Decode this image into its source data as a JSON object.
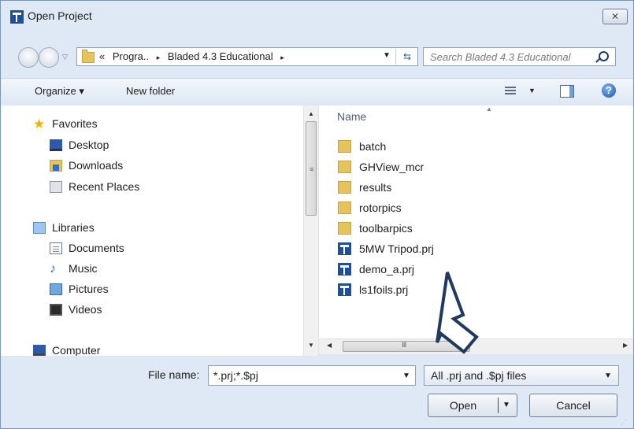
{
  "window": {
    "title": "Open Project",
    "close_label": "⨯"
  },
  "navigation": {
    "breadcrumbs": [
      "«",
      "Progra..",
      "▸",
      "Bladed 4.3 Educational",
      "▸"
    ],
    "search_placeholder": "Search Bladed 4.3 Educational"
  },
  "toolbar": {
    "organize_label": "Organize ▾",
    "new_folder_label": "New folder",
    "help_label": "?"
  },
  "sidebar": {
    "items": [
      {
        "label": "Favorites",
        "icon": "star-icon"
      },
      {
        "label": "Desktop",
        "icon": "desktop-icon"
      },
      {
        "label": "Downloads",
        "icon": "downloads-icon"
      },
      {
        "label": "Recent Places",
        "icon": "recent-places-icon"
      },
      {
        "label": "Libraries",
        "icon": "libraries-icon"
      },
      {
        "label": "Documents",
        "icon": "documents-icon"
      },
      {
        "label": "Music",
        "icon": "music-icon"
      },
      {
        "label": "Pictures",
        "icon": "pictures-icon"
      },
      {
        "label": "Videos",
        "icon": "videos-icon"
      },
      {
        "label": "Computer",
        "icon": "computer-icon"
      }
    ]
  },
  "file_list": {
    "column_header": "Name",
    "items": [
      {
        "name": "batch",
        "type": "folder"
      },
      {
        "name": "GHView_mcr",
        "type": "folder"
      },
      {
        "name": "results",
        "type": "folder"
      },
      {
        "name": "rotorpics",
        "type": "folder"
      },
      {
        "name": "toolbarpics",
        "type": "folder"
      },
      {
        "name": "5MW Tripod.prj",
        "type": "project"
      },
      {
        "name": "demo_a.prj",
        "type": "project"
      },
      {
        "name": "ls1foils.prj",
        "type": "project"
      }
    ]
  },
  "footer": {
    "file_name_label": "File name:",
    "file_name_value": "*.prj;*.$pj",
    "file_type_value": "All .prj and .$pj files",
    "open_label": "Open",
    "cancel_label": "Cancel"
  },
  "annotation": {
    "arrow_color": "#1f3a5c"
  }
}
